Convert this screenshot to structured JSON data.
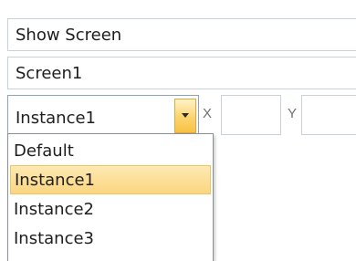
{
  "show_mode": {
    "selected": "Show Screen",
    "icon": "chevron-down-icon"
  },
  "screen": {
    "selected": "Screen1",
    "icon": "chevron-down-icon"
  },
  "instance": {
    "selected": "Instance1",
    "icon": "chevron-down-icon",
    "options": [
      {
        "label": "Default"
      },
      {
        "label": "Instance1"
      },
      {
        "label": "Instance2"
      },
      {
        "label": "Instance3"
      }
    ]
  },
  "position": {
    "x_label": "X",
    "y_label": "Y",
    "x_value": "",
    "y_value": ""
  },
  "colors": {
    "highlight": "#fbd680",
    "border": "#c9d2dc",
    "accent_button": "#f7c243"
  }
}
